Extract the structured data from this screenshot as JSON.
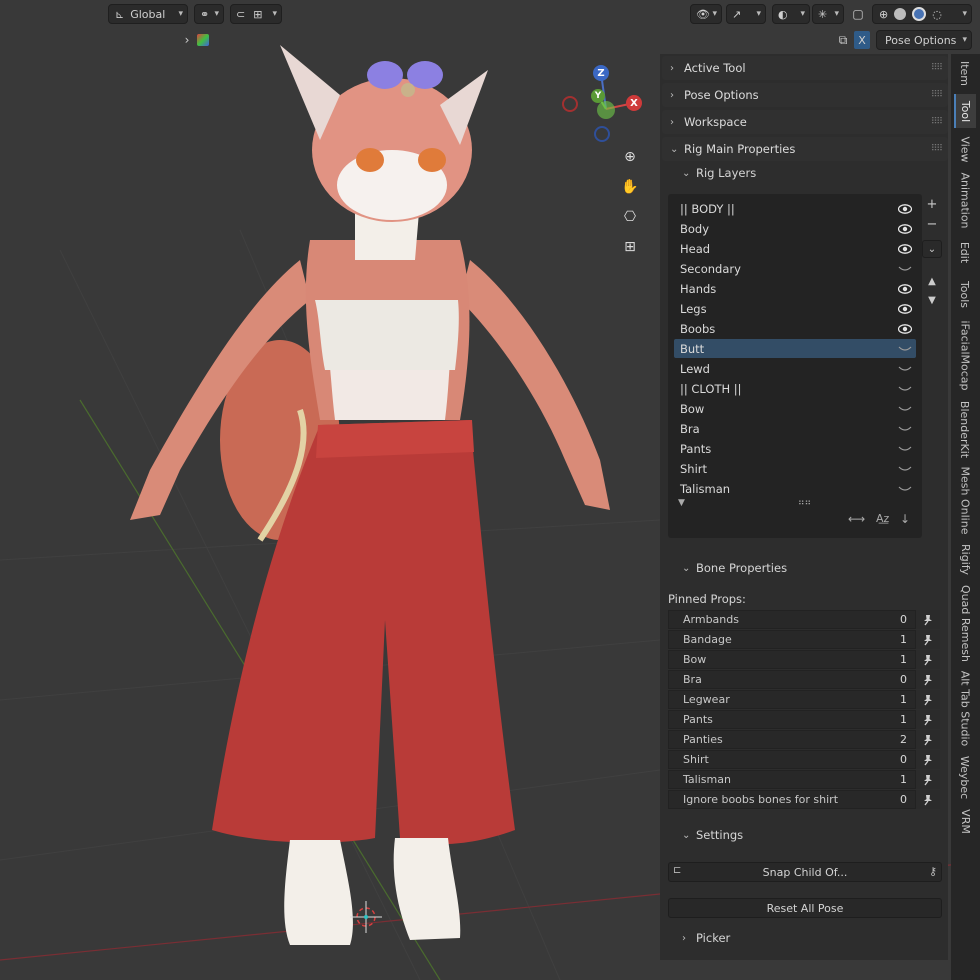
{
  "header": {
    "transform_orientation": "Global",
    "mode": "Pose Options",
    "x_mirror": "X"
  },
  "panel": {
    "sections": [
      {
        "label": "Active Tool",
        "open": false
      },
      {
        "label": "Pose Options",
        "open": false
      },
      {
        "label": "Workspace",
        "open": false
      },
      {
        "label": "Rig Main Properties",
        "open": true
      }
    ],
    "rig_layers": {
      "title": "Rig Layers",
      "items": [
        {
          "name": "|| BODY ||",
          "visible": true,
          "selected": false
        },
        {
          "name": "Body",
          "visible": true,
          "selected": false
        },
        {
          "name": "Head",
          "visible": true,
          "selected": false
        },
        {
          "name": "Secondary",
          "visible": false,
          "selected": false
        },
        {
          "name": "Hands",
          "visible": true,
          "selected": false
        },
        {
          "name": "Legs",
          "visible": true,
          "selected": false
        },
        {
          "name": "Boobs",
          "visible": true,
          "selected": false
        },
        {
          "name": "Butt",
          "visible": false,
          "selected": true
        },
        {
          "name": "Lewd",
          "visible": false,
          "selected": false
        },
        {
          "name": "|| CLOTH ||",
          "visible": false,
          "selected": false
        },
        {
          "name": "Bow",
          "visible": false,
          "selected": false
        },
        {
          "name": "Bra",
          "visible": false,
          "selected": false
        },
        {
          "name": "Pants",
          "visible": false,
          "selected": false
        },
        {
          "name": "Shirt",
          "visible": false,
          "selected": false
        },
        {
          "name": "Talisman",
          "visible": false,
          "selected": false
        }
      ]
    },
    "bone_properties": {
      "title": "Bone Properties",
      "pinned_label": "Pinned Props:",
      "props": [
        {
          "name": "Armbands",
          "value": "0"
        },
        {
          "name": "Bandage",
          "value": "1"
        },
        {
          "name": "Bow",
          "value": "1"
        },
        {
          "name": "Bra",
          "value": "0"
        },
        {
          "name": "Legwear",
          "value": "1"
        },
        {
          "name": "Pants",
          "value": "1"
        },
        {
          "name": "Panties",
          "value": "2"
        },
        {
          "name": "Shirt",
          "value": "0"
        },
        {
          "name": "Talisman",
          "value": "1"
        },
        {
          "name": "Ignore boobs bones for shirt",
          "value": "0"
        }
      ]
    },
    "settings": {
      "title": "Settings",
      "snap_label": "Snap Child Of...",
      "reset_label": "Reset All Pose"
    },
    "picker": {
      "title": "Picker"
    }
  },
  "gizmo": {
    "z": "Z",
    "x": "X",
    "y": "Y"
  },
  "tabs": [
    "Item",
    "Tool",
    "View",
    "Animation",
    "Edit",
    "Tools",
    "iFacialMocap",
    "BlenderKit",
    "Mesh Online",
    "Rigify",
    "Quad Remesh",
    "Alt Tab Studio",
    "Weybec",
    "VRM"
  ],
  "active_tab": "Tool"
}
